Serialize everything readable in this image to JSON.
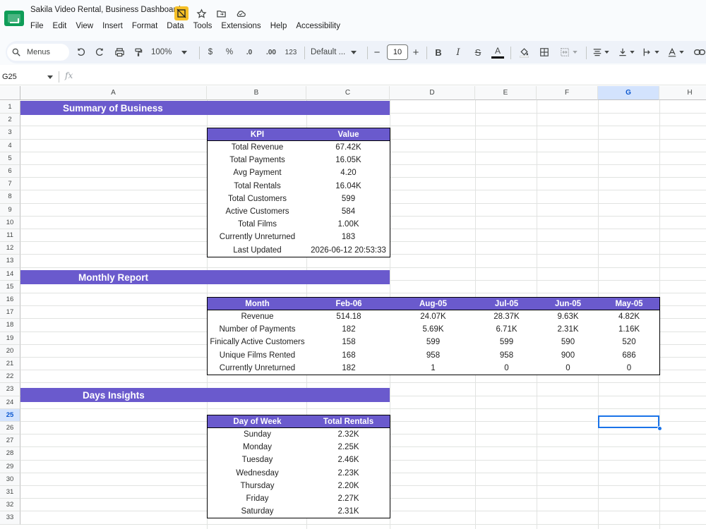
{
  "app": {
    "title": "Sakila Video Rental, Business Dashboard",
    "menu": [
      "File",
      "Edit",
      "View",
      "Insert",
      "Format",
      "Data",
      "Tools",
      "Extensions",
      "Help",
      "Accessibility"
    ]
  },
  "toolbar": {
    "search_label": "Menus",
    "zoom": "100%",
    "currency": "$",
    "percent": "%",
    "dec_decrease": ".0",
    "dec_increase": ".00",
    "number_format": "123",
    "font": "Default ...",
    "font_size": "10",
    "bold": "B",
    "italic": "I",
    "strikethrough": "S",
    "text_color": "A",
    "minus": "−",
    "plus": "+"
  },
  "formula_bar": {
    "cell_ref": "G25",
    "fx": "fx",
    "value": ""
  },
  "grid": {
    "columns": [
      "A",
      "B",
      "C",
      "D",
      "E",
      "F",
      "G",
      "H"
    ],
    "selected_column": "G",
    "rows": [
      "1",
      "2",
      "3",
      "4",
      "5",
      "6",
      "7",
      "8",
      "9",
      "10",
      "11",
      "12",
      "13",
      "14",
      "15",
      "16",
      "17",
      "18",
      "19",
      "20",
      "21",
      "22",
      "23",
      "24",
      "25",
      "26",
      "27",
      "28",
      "29",
      "30",
      "31",
      "32",
      "33"
    ],
    "selected_row": "25"
  },
  "sections": {
    "summary": "Summary of Business",
    "monthly": "Monthly Report",
    "days": "Days Insights"
  },
  "kpi_table": {
    "headers": [
      "KPI",
      "Value"
    ],
    "rows": [
      [
        "Total Revenue",
        "67.42K"
      ],
      [
        "Total Payments",
        "16.05K"
      ],
      [
        "Avg Payment",
        "4.20"
      ],
      [
        "Total Rentals",
        "16.04K"
      ],
      [
        "Total Customers",
        "599"
      ],
      [
        "Active Customers",
        "584"
      ],
      [
        "Total Films",
        "1.00K"
      ],
      [
        "Currently Unreturned",
        "183"
      ],
      [
        "Last Updated",
        "2026-06-12 20:53:33"
      ]
    ]
  },
  "monthly_table": {
    "headers": [
      "Month",
      "Feb-06",
      "Aug-05",
      "Jul-05",
      "Jun-05",
      "May-05"
    ],
    "rows": [
      [
        "Revenue",
        "514.18",
        "24.07K",
        "28.37K",
        "9.63K",
        "4.82K"
      ],
      [
        "Number of Payments",
        "182",
        "5.69K",
        "6.71K",
        "2.31K",
        "1.16K"
      ],
      [
        "Finically Active Customers",
        "158",
        "599",
        "599",
        "590",
        "520"
      ],
      [
        "Unique Films Rented",
        "168",
        "958",
        "958",
        "900",
        "686"
      ],
      [
        "Currently Unreturned",
        "182",
        "1",
        "0",
        "0",
        "0"
      ]
    ]
  },
  "days_table": {
    "headers": [
      "Day of Week",
      "Total Rentals"
    ],
    "rows": [
      [
        "Sunday",
        "2.32K"
      ],
      [
        "Monday",
        "2.25K"
      ],
      [
        "Tuesday",
        "2.46K"
      ],
      [
        "Wednesday",
        "2.23K"
      ],
      [
        "Thursday",
        "2.20K"
      ],
      [
        "Friday",
        "2.27K"
      ],
      [
        "Saturday",
        "2.31K"
      ]
    ]
  },
  "colors": {
    "banner": "#6a5acd",
    "selection": "#1a73e8",
    "sheets_green": "#0f9d58"
  }
}
